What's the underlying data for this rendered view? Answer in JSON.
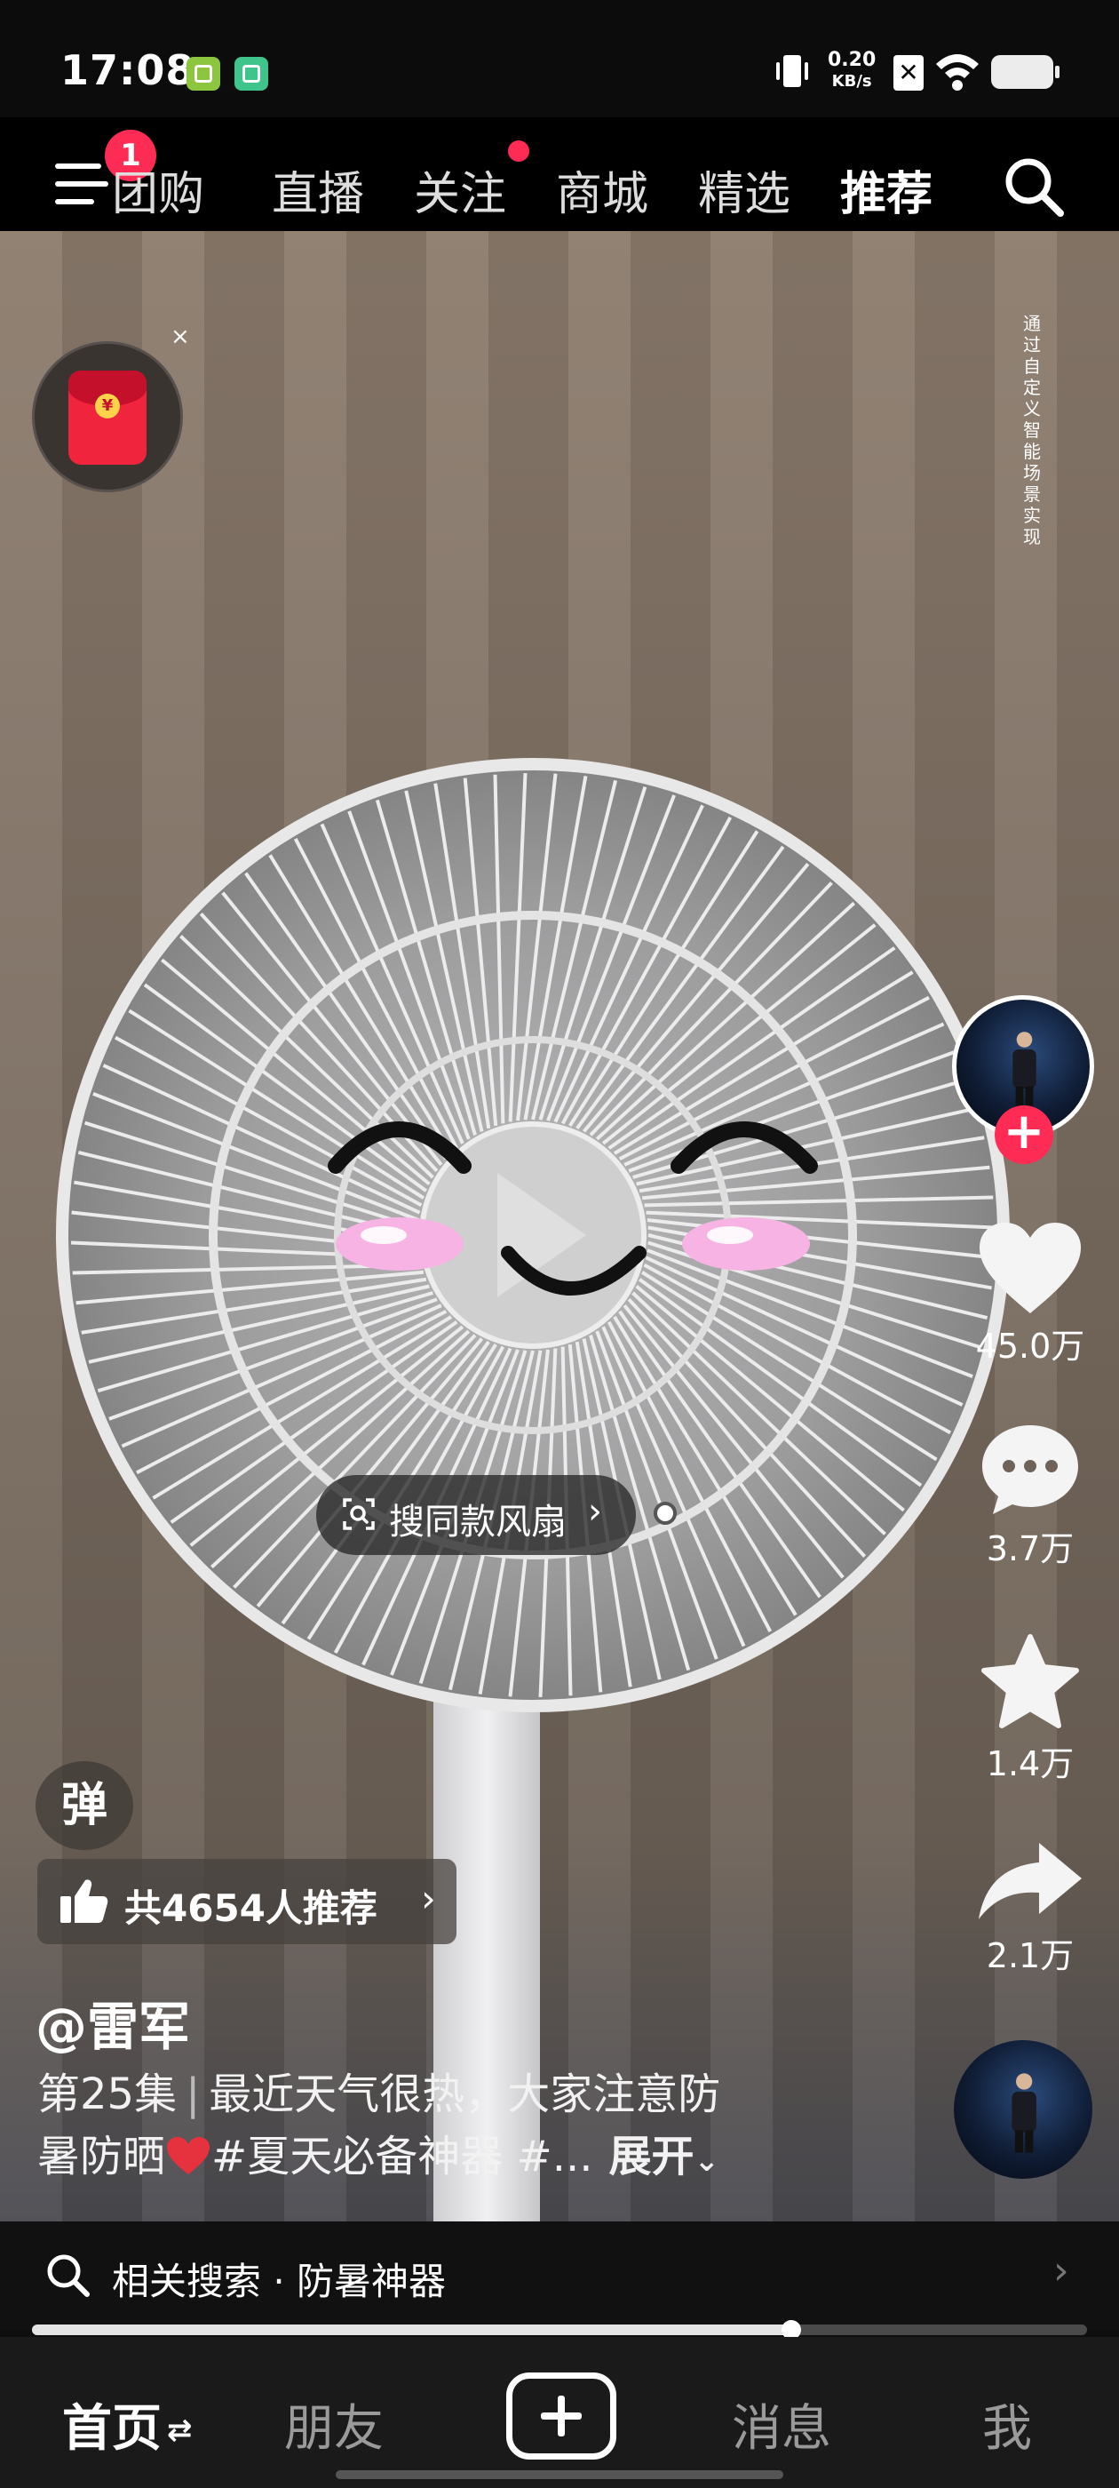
{
  "status_bar": {
    "time": "17:08",
    "net_speed_value": "0.20",
    "net_speed_unit": "KB/s",
    "icons": [
      "checklist-app-icon",
      "scan-app-icon",
      "vibrate-icon",
      "sim-disabled-icon",
      "wifi-icon",
      "battery-icon"
    ]
  },
  "top_nav": {
    "menu_badge": "1",
    "tabs": [
      {
        "label": "团购"
      },
      {
        "label": "直播"
      },
      {
        "label": "关注"
      },
      {
        "label": "商城"
      },
      {
        "label": "精选"
      },
      {
        "label": "推荐"
      }
    ],
    "active_tab": "推荐"
  },
  "video": {
    "vertical_caption": "通过自定义智能场景实现",
    "product_search_label": "搜同款风扇",
    "redpacket_close": "×"
  },
  "actions": {
    "likes": "45.0万",
    "comments": "3.7万",
    "favorites": "1.4万",
    "shares": "2.1万"
  },
  "overlay": {
    "danmu": "弹",
    "recommend_label": "共4654人推荐",
    "author": "@雷军",
    "caption_episode": "第25集",
    "caption_text_1": "最近天气很热，大家注意防",
    "caption_text_2": "暑防晒",
    "caption_tags": "#夏天必备神器 #...",
    "expand_label": "展开"
  },
  "related_search": {
    "label": "相关搜索 · 防暑神器"
  },
  "playback": {
    "progress_fraction": 0.72
  },
  "bottom_nav": {
    "home": "首页",
    "friends": "朋友",
    "messages": "消息",
    "me": "我"
  },
  "colors": {
    "accent": "#fe2c55",
    "background": "#000000"
  }
}
